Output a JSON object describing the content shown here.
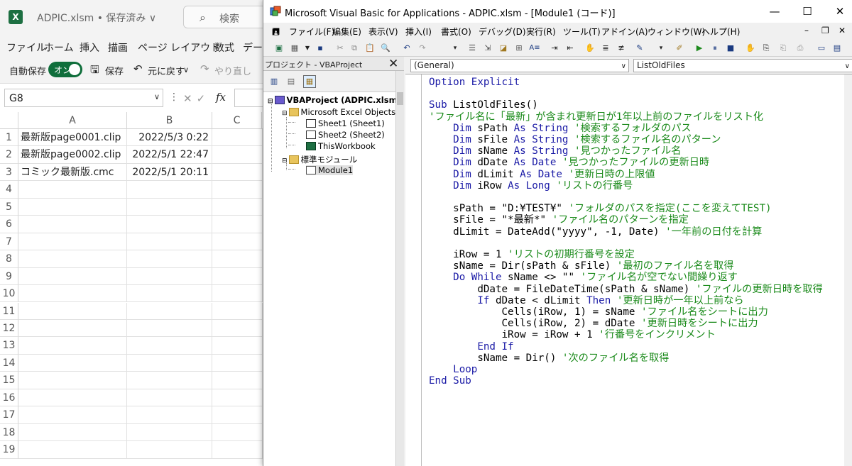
{
  "excel": {
    "app_icon": "excel-logo-icon",
    "app_icon_letter": "X",
    "filename": "ADPIC.xlsm • 保存済み ∨",
    "search_placeholder": "検索",
    "menu": [
      "ファイル",
      "ホーム",
      "挿入",
      "描画",
      "ページ レイアウト",
      "数式",
      "データ"
    ],
    "autosave_label": "自動保存",
    "autosave_state": "オン",
    "save_label": "保存",
    "undo_label": "元に戻す",
    "redo_label": "やり直し",
    "name_box": "G8",
    "fx_label": "fx",
    "columns": [
      "A",
      "B",
      "C"
    ],
    "rows": [
      "1",
      "2",
      "3",
      "4",
      "5",
      "6",
      "7",
      "8",
      "9",
      "10",
      "11",
      "12",
      "13",
      "14",
      "15",
      "16",
      "17",
      "18",
      "19"
    ],
    "cells": [
      {
        "a": "最新版page0001.clip",
        "b": "2022/5/3 0:22"
      },
      {
        "a": "最新版page0002.clip",
        "b": "2022/5/1 22:47"
      },
      {
        "a": "コミック最新版.cmc",
        "b": "2022/5/1 20:11"
      }
    ]
  },
  "vba": {
    "title": "Microsoft Visual Basic for Applications - ADPIC.xlsm - [Module1 (コード)]",
    "window_buttons": {
      "minimize": "—",
      "maximize": "☐",
      "close": "✕"
    },
    "menu": [
      "ファイル(F)",
      "編集(E)",
      "表示(V)",
      "挿入(I)",
      "書式(O)",
      "デバッグ(D)",
      "実行(R)",
      "ツール(T)",
      "アドイン(A)",
      "ウィンドウ(W)",
      "ヘルプ(H)"
    ],
    "project": {
      "title": "プロジェクト - VBAProject",
      "close": "✕",
      "root": "VBAProject (ADPIC.xlsm)",
      "excel_objects": "Microsoft Excel Objects",
      "sheet1": "Sheet1 (Sheet1)",
      "sheet2": "Sheet2 (Sheet2)",
      "workbook": "ThisWorkbook",
      "std_modules": "標準モジュール",
      "module1": "Module1"
    },
    "object_combo": "(General)",
    "proc_combo": "ListOldFiles",
    "code": [
      [
        [
          "kw",
          "Option Explicit"
        ]
      ],
      [],
      [
        [
          "kw",
          "Sub "
        ],
        [
          "tx",
          "ListOldFiles()"
        ]
      ],
      [
        [
          "cm",
          "'ファイル名に「最新」が含まれ更新日が1年以上前のファイルをリスト化"
        ]
      ],
      [
        [
          "kw",
          "    Dim "
        ],
        [
          "tx",
          "sPath "
        ],
        [
          "kw",
          "As String "
        ],
        [
          "cm",
          "'検索するフォルダのパス"
        ]
      ],
      [
        [
          "kw",
          "    Dim "
        ],
        [
          "tx",
          "sFile "
        ],
        [
          "kw",
          "As String "
        ],
        [
          "cm",
          "'検索するファイル名のパターン"
        ]
      ],
      [
        [
          "kw",
          "    Dim "
        ],
        [
          "tx",
          "sName "
        ],
        [
          "kw",
          "As String "
        ],
        [
          "cm",
          "'見つかったファイル名"
        ]
      ],
      [
        [
          "kw",
          "    Dim "
        ],
        [
          "tx",
          "dDate "
        ],
        [
          "kw",
          "As Date "
        ],
        [
          "cm",
          "'見つかったファイルの更新日時"
        ]
      ],
      [
        [
          "kw",
          "    Dim "
        ],
        [
          "tx",
          "dLimit "
        ],
        [
          "kw",
          "As Date "
        ],
        [
          "cm",
          "'更新日時の上限値"
        ]
      ],
      [
        [
          "kw",
          "    Dim "
        ],
        [
          "tx",
          "iRow "
        ],
        [
          "kw",
          "As Long "
        ],
        [
          "cm",
          "'リストの行番号"
        ]
      ],
      [],
      [
        [
          "tx",
          "    sPath = \"D:¥TEST¥\" "
        ],
        [
          "cm",
          "'フォルダのパスを指定(ここを変えてTEST)"
        ]
      ],
      [
        [
          "tx",
          "    sFile = \"*最新*\" "
        ],
        [
          "cm",
          "'ファイル名のパターンを指定"
        ]
      ],
      [
        [
          "tx",
          "    dLimit = DateAdd(\"yyyy\", -1, Date) "
        ],
        [
          "cm",
          "'一年前の日付を計算"
        ]
      ],
      [],
      [
        [
          "tx",
          "    iRow = 1 "
        ],
        [
          "cm",
          "'リストの初期行番号を設定"
        ]
      ],
      [
        [
          "tx",
          "    sName = Dir(sPath & sFile) "
        ],
        [
          "cm",
          "'最初のファイル名を取得"
        ]
      ],
      [
        [
          "kw",
          "    Do While "
        ],
        [
          "tx",
          "sName <> \"\" "
        ],
        [
          "cm",
          "'ファイル名が空でない間繰り返す"
        ]
      ],
      [
        [
          "tx",
          "        dDate = FileDateTime(sPath & sName) "
        ],
        [
          "cm",
          "'ファイルの更新日時を取得"
        ]
      ],
      [
        [
          "kw",
          "        If "
        ],
        [
          "tx",
          "dDate < dLimit "
        ],
        [
          "kw",
          "Then "
        ],
        [
          "cm",
          "'更新日時が一年以上前なら"
        ]
      ],
      [
        [
          "tx",
          "            Cells(iRow, 1) = sName "
        ],
        [
          "cm",
          "'ファイル名をシートに出力"
        ]
      ],
      [
        [
          "tx",
          "            Cells(iRow, 2) = dDate "
        ],
        [
          "cm",
          "'更新日時をシートに出力"
        ]
      ],
      [
        [
          "tx",
          "            iRow = iRow + 1 "
        ],
        [
          "cm",
          "'行番号をインクリメント"
        ]
      ],
      [
        [
          "kw",
          "        End If"
        ]
      ],
      [
        [
          "tx",
          "        sName = Dir() "
        ],
        [
          "cm",
          "'次のファイル名を取得"
        ]
      ],
      [
        [
          "kw",
          "    Loop"
        ]
      ],
      [
        [
          "kw",
          "End Sub"
        ]
      ]
    ]
  }
}
